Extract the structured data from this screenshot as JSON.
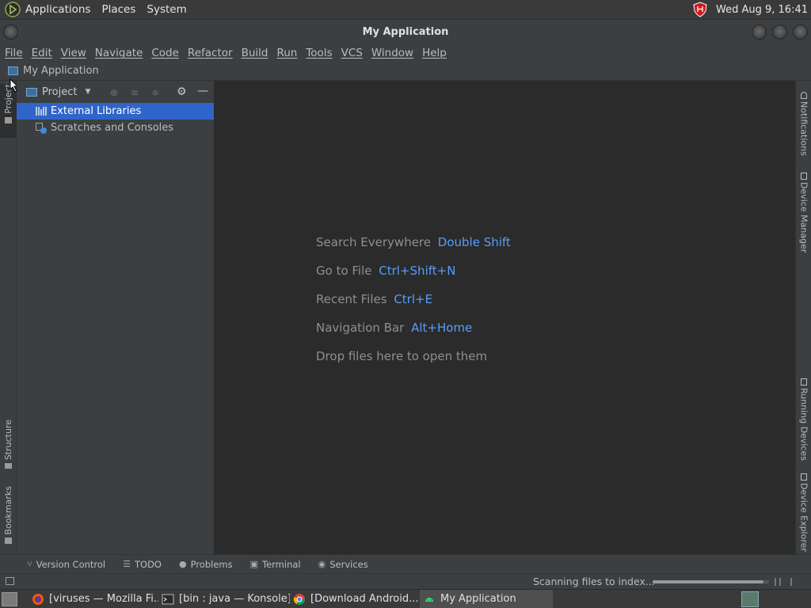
{
  "system_panel": {
    "menus": [
      "Applications",
      "Places",
      "System"
    ],
    "clock": "Wed Aug  9, 16:41"
  },
  "window": {
    "title": "My Application"
  },
  "menubar": {
    "items": [
      "File",
      "Edit",
      "View",
      "Navigate",
      "Code",
      "Refactor",
      "Build",
      "Run",
      "Tools",
      "VCS",
      "Window",
      "Help"
    ]
  },
  "navbar": {
    "project": "My Application"
  },
  "left_stripe": {
    "project": "Project",
    "structure": "Structure",
    "bookmarks": "Bookmarks"
  },
  "project_panel": {
    "view_label": "Project",
    "tree": [
      {
        "label": "External Libraries",
        "selected": true
      },
      {
        "label": "Scratches and Consoles",
        "selected": false
      }
    ]
  },
  "editor_hints": [
    {
      "text": "Search Everywhere",
      "key": "Double Shift"
    },
    {
      "text": "Go to File",
      "key": "Ctrl+Shift+N"
    },
    {
      "text": "Recent Files",
      "key": "Ctrl+E"
    },
    {
      "text": "Navigation Bar",
      "key": "Alt+Home"
    },
    {
      "text": "Drop files here to open them",
      "key": ""
    }
  ],
  "right_stripe": {
    "notifications": "Notifications",
    "device_manager": "Device Manager",
    "running_devices": "Running Devices",
    "device_explorer": "Device Explorer"
  },
  "bottom_tools": [
    "Version Control",
    "TODO",
    "Problems",
    "Terminal",
    "Services"
  ],
  "statusbar": {
    "text": "Scanning files to index...",
    "progress": 0.95
  },
  "taskbar": {
    "tasks": [
      "[viruses — Mozilla Fi...",
      "[bin : java — Konsole]",
      "[Download Android...",
      "My Application"
    ]
  },
  "colors": {
    "accent": "#589df6",
    "selection": "#2f65ca",
    "editor_bg": "#2b2b2b",
    "panel_bg": "#3c3f41"
  }
}
